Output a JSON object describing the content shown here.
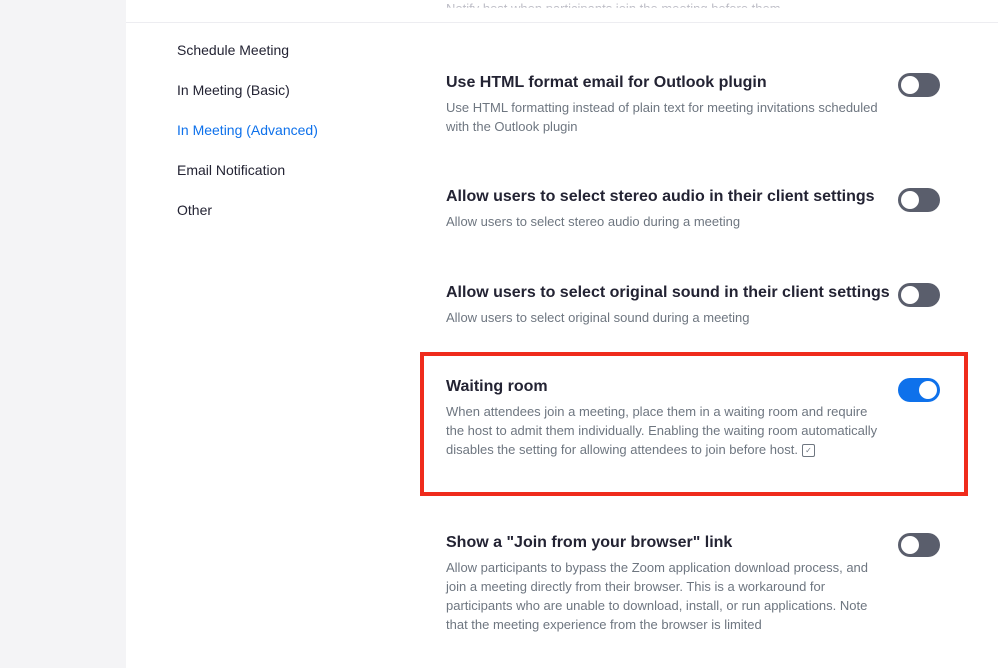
{
  "header": {
    "faded_text": "Notify host when participants join the meeting before them"
  },
  "nav": {
    "items": [
      {
        "label": "Schedule Meeting",
        "active": false
      },
      {
        "label": "In Meeting (Basic)",
        "active": false
      },
      {
        "label": "In Meeting (Advanced)",
        "active": true
      },
      {
        "label": "Email Notification",
        "active": false
      },
      {
        "label": "Other",
        "active": false
      }
    ]
  },
  "settings": [
    {
      "title": "Use HTML format email for Outlook plugin",
      "description": "Use HTML formatting instead of plain text for meeting invitations scheduled with the Outlook plugin",
      "enabled": false
    },
    {
      "title": "Allow users to select stereo audio in their client settings",
      "description": "Allow users to select stereo audio during a meeting",
      "enabled": false
    },
    {
      "title": "Allow users to select original sound in their client settings",
      "description": "Allow users to select original sound during a meeting",
      "enabled": false
    },
    {
      "title": "Waiting room",
      "description": "When attendees join a meeting, place them in a waiting room and require the host to admit them individually. Enabling the waiting room automatically disables the setting for allowing attendees to join before host.",
      "enabled": true,
      "info_icon": "info-icon"
    },
    {
      "title": "Show a \"Join from your browser\" link",
      "description": "Allow participants to bypass the Zoom application download process, and join a meeting directly from their browser. This is a workaround for participants who are unable to download, install, or run applications. Note that the meeting experience from the browser is limited",
      "enabled": false
    }
  ],
  "colors": {
    "accent": "#0e71eb",
    "toggle_off": "#5a5e6c",
    "highlight": "#ef2b1c",
    "gutter": "#f4f4f6"
  }
}
